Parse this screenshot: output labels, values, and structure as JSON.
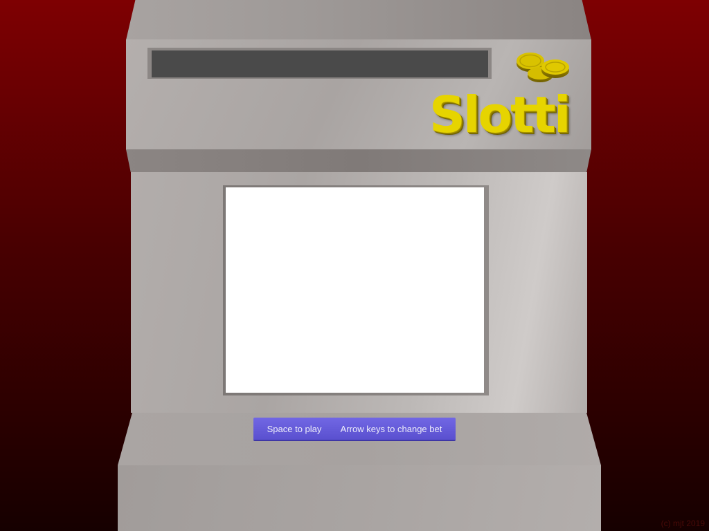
{
  "game": {
    "logo_text": "Slotti",
    "display": {
      "text": ""
    },
    "controls": {
      "play_hint": "Space to play",
      "bet_hint": "Arrow keys to change bet"
    },
    "copyright": "(c) mjt 2019",
    "icons": {
      "coins": "coin-stack-icon"
    },
    "colors": {
      "background_top": "#7e0002",
      "background_bottom": "#160000",
      "cabinet": "#aaa5a3",
      "display": "#4a4a4a",
      "logo": "#e6d400",
      "plate": "#6a60de"
    }
  }
}
